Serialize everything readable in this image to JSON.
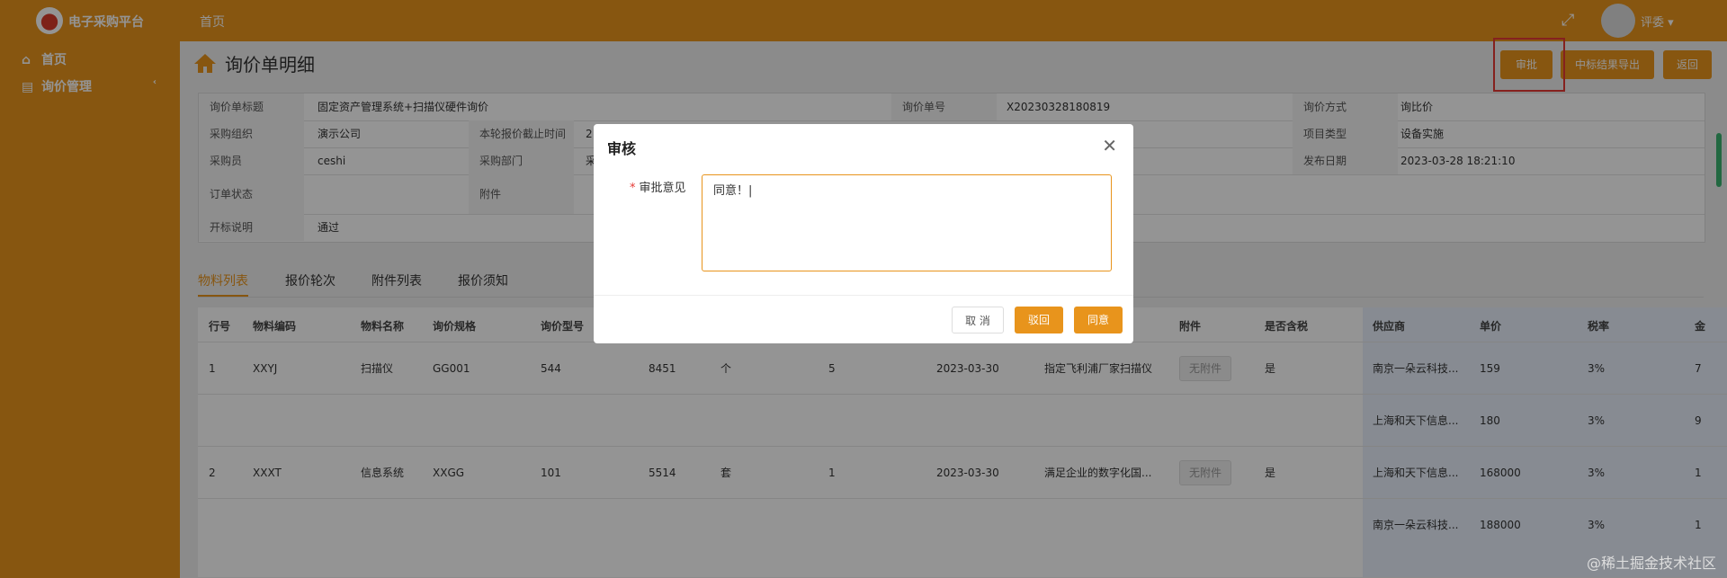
{
  "app": {
    "brand": "电子采购平台",
    "nav_home": "首页",
    "user": "评委 ▾"
  },
  "sidebar": {
    "items": [
      {
        "label": "首页"
      },
      {
        "label": "询价管理"
      }
    ]
  },
  "page": {
    "title": "询价单明细"
  },
  "actions": {
    "approve": "审批",
    "export": "中标结果导出",
    "back": "返回"
  },
  "info": {
    "r1": {
      "l1": "询价单标题",
      "v1": "固定资产管理系统+扫描仪硬件询价",
      "l2": "询价单号",
      "v2": "X20230328180819",
      "l3": "询价方式",
      "v3": "询比价"
    },
    "r2": {
      "l1": "采购组织",
      "v1": "演示公司",
      "l2": "本轮报价截止时间",
      "v2": "2",
      "l3": "项目类型",
      "v3": "设备实施"
    },
    "r3": {
      "l1": "采购员",
      "v1": "ceshi",
      "l2": "采购部门",
      "v2": "采",
      "l3": "发布日期",
      "v3": "2023-03-28 18:21:10"
    },
    "r4": {
      "l1": "订单状态",
      "v1": "",
      "l2": "附件",
      "v2": ""
    },
    "r5": {
      "l1": "开标说明",
      "v1": "通过"
    }
  },
  "tabs": [
    {
      "label": "物料列表"
    },
    {
      "label": "报价轮次"
    },
    {
      "label": "附件列表"
    },
    {
      "label": "报价须知"
    }
  ],
  "table": {
    "headers": {
      "h1": "行号",
      "h2": "物料编码",
      "h3": "物料名称",
      "h4": "询价规格",
      "h5": "询价型号",
      "h6": "附件",
      "h7": "是否含税",
      "h8": "供应商",
      "h9": "单价",
      "h10": "税率",
      "h11": "金"
    },
    "rows": [
      {
        "no": "1",
        "code": "XXYJ",
        "name": "扫描仪",
        "spec": "GG001",
        "model": "544",
        "qty": "8451",
        "unit": "个",
        "num": "5",
        "date": "2023-03-30",
        "desc": "指定飞利浦厂家扫描仪",
        "att": "无附件",
        "tax": "是",
        "supplier": "南京一朵云科技...",
        "price": "159",
        "rate": "3%",
        "amount": "7"
      },
      {
        "supplier": "上海和天下信息...",
        "price": "180",
        "rate": "3%",
        "amount": "9"
      },
      {
        "no": "2",
        "code": "XXXT",
        "name": "信息系统",
        "spec": "XXGG",
        "model": "101",
        "qty": "5514",
        "unit": "套",
        "num": "1",
        "date": "2023-03-30",
        "desc": "满足企业的数字化国...",
        "att": "无附件",
        "tax": "是",
        "supplier": "上海和天下信息...",
        "price": "168000",
        "rate": "3%",
        "amount": "1"
      },
      {
        "supplier": "南京一朵云科技...",
        "price": "188000",
        "rate": "3%",
        "amount": "1"
      }
    ]
  },
  "modal": {
    "title": "审核",
    "field_label": "审批意见",
    "value": "同意！|",
    "cancel": "取 消",
    "reject": "驳回",
    "agree": "同意"
  },
  "watermark": "@稀土掘金技术社区"
}
